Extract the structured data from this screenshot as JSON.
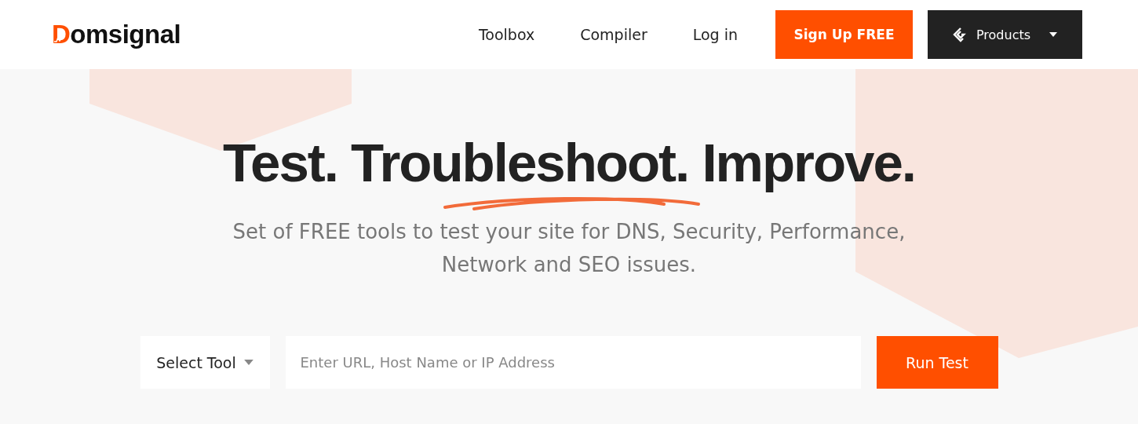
{
  "header": {
    "logo": "Domsignal",
    "nav": [
      {
        "label": "Toolbox"
      },
      {
        "label": "Compiler"
      },
      {
        "label": "Log in"
      }
    ],
    "signup": "Sign Up FREE",
    "products": "Products"
  },
  "hero": {
    "headline": "Test. Troubleshoot. Improve.",
    "subtitle": "Set of FREE tools to test your site for DNS, Security, Performance, Network and SEO issues."
  },
  "search": {
    "select": "Select Tool",
    "placeholder": "Enter URL, Host Name or IP Address",
    "button": "Run Test"
  }
}
